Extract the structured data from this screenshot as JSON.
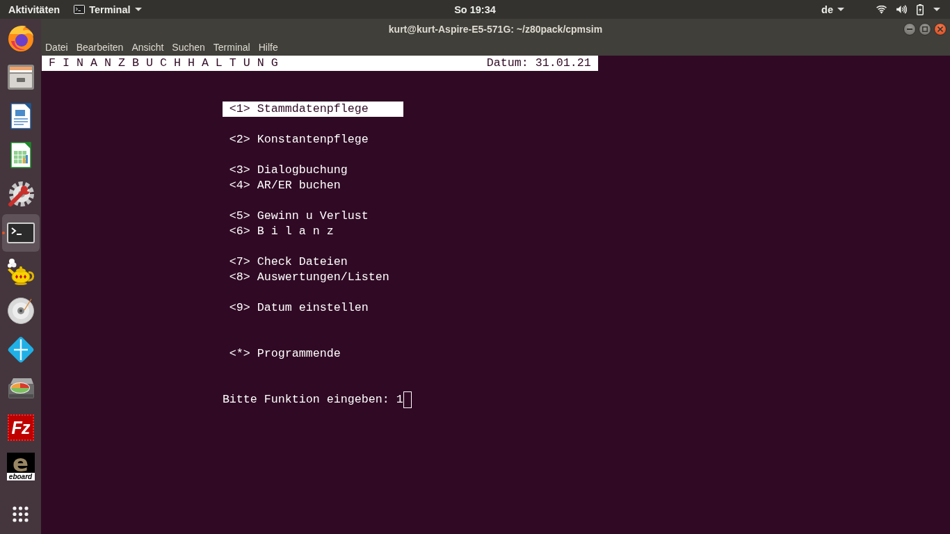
{
  "top_bar": {
    "activities": "Aktivitäten",
    "app_menu": "Terminal",
    "clock": "So 19:34",
    "keyboard_layout": "de"
  },
  "dock": {
    "apps": [
      {
        "kind": "browser",
        "selected": false,
        "running": false
      },
      {
        "kind": "files",
        "selected": false,
        "running": false
      },
      {
        "kind": "document",
        "selected": false,
        "running": false
      },
      {
        "kind": "spreadsheet",
        "selected": false,
        "running": false
      },
      {
        "kind": "settings",
        "selected": false,
        "running": false
      },
      {
        "kind": "terminal",
        "selected": true,
        "running": true
      },
      {
        "kind": "teapot",
        "selected": false,
        "running": false
      },
      {
        "kind": "disc",
        "selected": false,
        "running": false
      },
      {
        "kind": "media-center",
        "selected": false,
        "running": false
      },
      {
        "kind": "disk-usage",
        "selected": false,
        "running": false
      },
      {
        "kind": "ftp",
        "logo_text": "Fz",
        "selected": false,
        "running": false
      },
      {
        "kind": "eboard",
        "logo_text": "e",
        "caption": "eboard",
        "selected": false,
        "running": false
      }
    ]
  },
  "window": {
    "title": "kurt@kurt-Aspire-E5-571G: ~/z80pack/cpmsim",
    "menu": [
      "Datei",
      "Bearbeiten",
      "Ansicht",
      "Suchen",
      "Terminal",
      "Hilfe"
    ]
  },
  "terminal": {
    "header": {
      "title": "F I N A N Z B U C H H A L T U N G",
      "date": "Datum: 31.01.21"
    },
    "menu_groups": [
      {
        "items": [
          {
            "text": "<1> Stammdatenpflege",
            "selected": true
          }
        ]
      },
      {
        "items": [
          {
            "text": "<2> Konstantenpflege",
            "selected": false
          }
        ]
      },
      {
        "items": [
          {
            "text": "<3> Dialogbuchung",
            "selected": false
          },
          {
            "text": "<4> AR/ER buchen",
            "selected": false
          }
        ]
      },
      {
        "items": [
          {
            "text": "<5> Gewinn u Verlust",
            "selected": false
          },
          {
            "text": "<6> B i l a n z",
            "selected": false
          }
        ]
      },
      {
        "items": [
          {
            "text": "<7> Check Dateien",
            "selected": false
          },
          {
            "text": "<8> Auswertungen/Listen",
            "selected": false
          }
        ]
      },
      {
        "items": [
          {
            "text": "<9> Datum einstellen",
            "selected": false
          }
        ]
      },
      {
        "items": [
          {
            "text": "<*> Programmende",
            "selected": false
          }
        ]
      }
    ],
    "prompt": {
      "label": "Bitte Funktion eingeben:",
      "value": "1"
    }
  }
}
